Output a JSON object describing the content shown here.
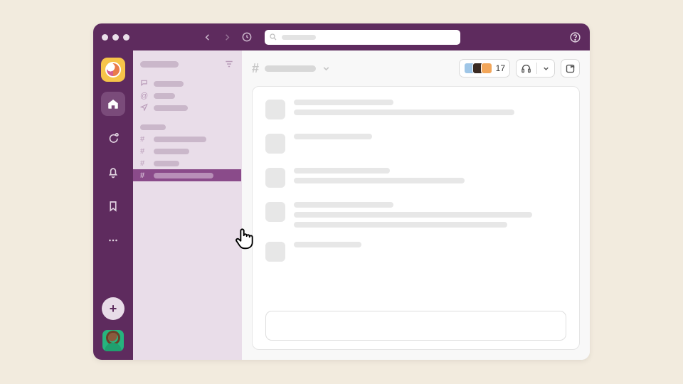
{
  "colors": {
    "brand": "#5e2b5e",
    "accent": "#8a4b8a",
    "bg": "#f2ebde"
  },
  "titlebar": {
    "back_icon": "arrow-left",
    "forward_icon": "arrow-right",
    "history_icon": "clock",
    "search_icon": "magnifier",
    "search_placeholder": "",
    "help_icon": "help-circle"
  },
  "rail": {
    "workspace_name": "",
    "items": [
      {
        "name": "home-icon",
        "active": true
      },
      {
        "name": "dm-icon",
        "active": false
      },
      {
        "name": "activity-icon",
        "active": false
      },
      {
        "name": "later-icon",
        "active": false
      },
      {
        "name": "more-icon",
        "active": false
      }
    ],
    "add_label": "+",
    "user_avatar": "user"
  },
  "sidebar": {
    "workspace_label": "",
    "filter_icon": "filter",
    "top_items": [
      {
        "icon": "message-icon",
        "label": ""
      },
      {
        "icon": "mention-icon",
        "label": ""
      },
      {
        "icon": "sent-icon",
        "label": ""
      }
    ],
    "section_label": "",
    "channels": [
      {
        "label": "",
        "selected": false
      },
      {
        "label": "",
        "selected": false
      },
      {
        "label": "",
        "selected": false
      },
      {
        "label": "",
        "selected": true
      }
    ]
  },
  "channel": {
    "hash": "#",
    "name": "",
    "chevron_icon": "chevron-down",
    "members": {
      "count": "17",
      "faces": [
        "#9fc6e7",
        "#3a2a22",
        "#f2a65a"
      ]
    },
    "huddle_icon": "headphones",
    "huddle_chevron": "chevron-down",
    "canvas_icon": "note"
  },
  "messages": [
    {
      "lines": [
        140,
        310
      ]
    },
    {
      "lines": [
        110
      ]
    },
    {
      "lines": [
        135,
        240
      ]
    },
    {
      "lines": [
        140,
        335,
        300
      ]
    },
    {
      "lines": [
        95
      ]
    }
  ],
  "composer": {
    "placeholder": ""
  },
  "cursor_icon": "pointer-hand"
}
